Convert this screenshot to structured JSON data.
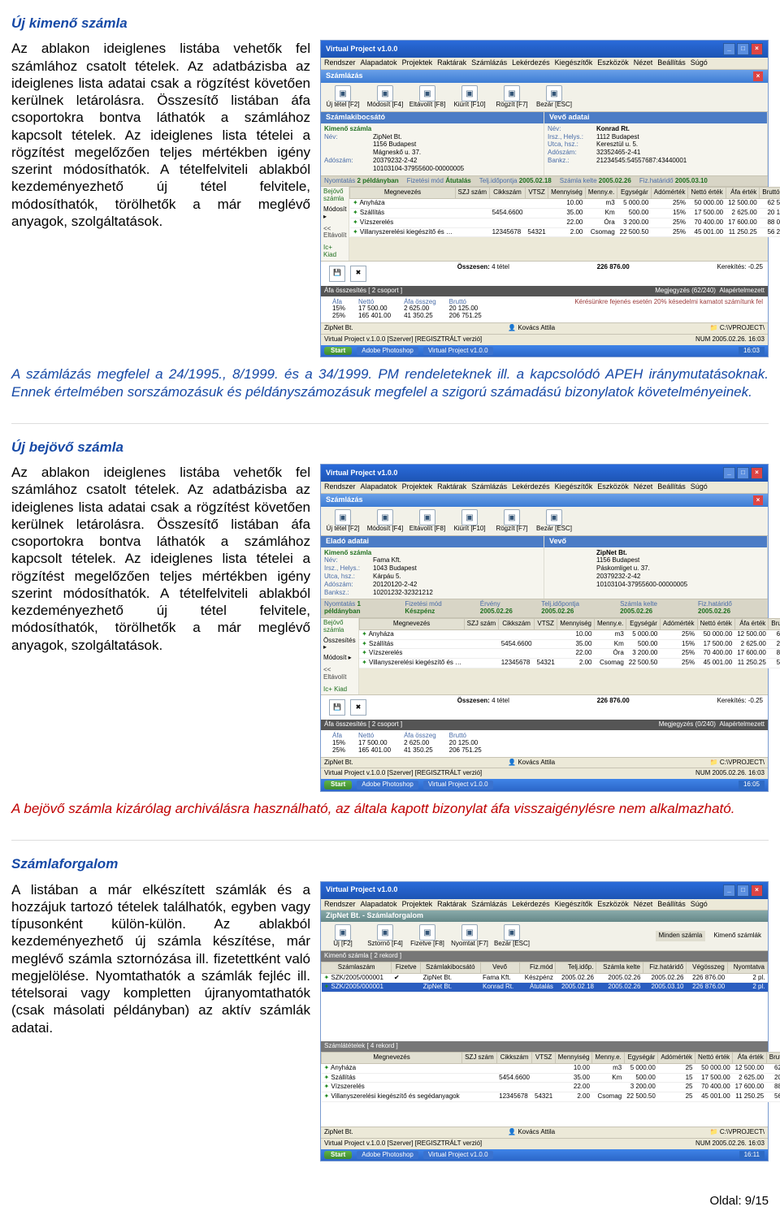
{
  "section1": {
    "heading": "Új kimenő számla",
    "para1": "Az ablakon ideiglenes listába vehetők fel számlához csatolt tételek. Az adatbázisba az ideiglenes lista adatai csak a rögzítést követően kerülnek letárolásra. Összesítő listában áfa csoportokra bontva láthatók a számlához kapcsolt tételek. Az ideiglenes lista tételei a rögzítést megelőzően teljes mértékben igény szerint módosíthatók. A tételfelviteli ablakból kezdeményezhető új tétel felvitele, módosíthatók, törölhetők a már meglévő anyagok, szolgáltatások.",
    "blue": "A számlázás megfelel a 24/1995., 8/1999. és a 34/1999. PM rendeleteknek ill. a kapcsolódó APEH iránymutatásoknak. Ennek értelmében sorszámozásuk és példányszámozásuk megfelel a szigorú számadású bizonylatok követelményeinek."
  },
  "section2": {
    "heading": "Új bejövő számla",
    "para1": "Az ablakon ideiglenes listába vehetők fel számlához csatolt tételek. Az adatbázisba az ideiglenes lista adatai csak a rögzítést követően kerülnek letárolásra. Összesítő listában áfa csoportokra bontva láthatók a számlához kapcsolt tételek. Az ideiglenes lista tételei a rögzítést megelőzően teljes mértékben igény szerint módosíthatók. A tételfelviteli ablakból kezdeményezhető új tétel felvitele, módosíthatók, törölhetők a már meglévő anyagok, szolgáltatások.",
    "red": "A bejövő számla kizárólag archiválásra használható, az általa kapott bizonylat áfa visszaigénylésre nem alkalmazható."
  },
  "section3": {
    "heading": "Számlaforgalom",
    "para1": "A listában a már elkészített számlák és a hozzájuk tartozó tételek találhatók, egyben vagy típusonként külön-külön. Az ablakból kezdeményezhető új számla készítése, már meglévő számla sztornózása ill. fizetettként való megjelölése. Nyomtathatók a számlák fejléc ill. tételsorai vagy kompletten újranyomtathatók (csak másolati példányban) az aktív számlák adatai."
  },
  "footer": "Oldal: 9/15",
  "shot_common": {
    "title": "Virtual Project v1.0.0",
    "menus": [
      "Rendszer",
      "Alapadatok",
      "Projektek",
      "Raktárak",
      "Számlázás",
      "Lekérdezés",
      "Kiegészítők",
      "Eszközök",
      "Nézet",
      "Beállítás",
      "Súgó"
    ],
    "subtitle": "Számlázás",
    "toolbar": [
      {
        "k": "Új tétel [F2]"
      },
      {
        "k": "Módosít [F4]"
      },
      {
        "k": "Eltávolít [F8]"
      },
      {
        "k": "Kiürít [F10]"
      },
      {
        "k": "Rögzít [F7]"
      },
      {
        "k": "Bezár [ESC]"
      }
    ],
    "grid_headers": [
      "Megnevezés",
      "SZJ szám",
      "Cikkszám",
      "VTSZ",
      "Mennyiség",
      "Menny.e.",
      "Egységár",
      "Adómérték",
      "Nettó érték",
      "Áfa érték",
      "Bruttó érték"
    ],
    "grid_rows": [
      [
        "Anyháza",
        "",
        "",
        "",
        "10.00",
        "m3",
        "5 000.00",
        "25%",
        "50 000.00",
        "12 500.00",
        "62 500.00"
      ],
      [
        "Szállítás",
        "",
        "5454.6600",
        "",
        "35.00",
        "Km",
        "500.00",
        "15%",
        "17 500.00",
        "2 625.00",
        "20 125.00"
      ],
      [
        "Vízszerelés",
        "",
        "",
        "",
        "22.00",
        "Óra",
        "3 200.00",
        "25%",
        "70 400.00",
        "17 600.00",
        "88 000.00"
      ],
      [
        "Villanyszerelési kiegészítő és …",
        "",
        "12345678",
        "54321",
        "2.00",
        "Csomag",
        "22 500.50",
        "25%",
        "45 001.00",
        "11 250.25",
        "56 251.25"
      ]
    ],
    "sum_label": "Összesen:",
    "sum_count": "4 tétel",
    "sum_total": "226 876.00",
    "kerekites": "Kerekítés: -0.25",
    "afa_bar": "Áfa összesítés [ 2 csoport ]",
    "meg_bar1": "Megjegyzés (62/240)",
    "meg_note1": "Kérésünkre fejenés esetén 20% késedelmi kamatot számítunk fel",
    "meg_bar2": "Megjegyzés (0/240)",
    "vat_headers": [
      "Áfa",
      "Nettó",
      "Áfa összeg",
      "Bruttó"
    ],
    "vat_rows": [
      [
        "15%",
        "17 500.00",
        "2 625.00",
        "20 125.00"
      ],
      [
        "25%",
        "165 401.00",
        "41 350.25",
        "206 751.25"
      ]
    ],
    "status_left": "ZipNet Bt.",
    "status_mid1": "Kovács Attila",
    "status_mid2": "C:\\VPROJECT\\",
    "status_line2": "Virtual Project v.1.0.0 [Szerver] [REGISZTRÁLT verzió]",
    "status_right": "NUM    2005.02.26. 16:03",
    "task_items": [
      "Adobe Photoshop",
      "Virtual Project v1.0.0"
    ],
    "task_clock1": "16:03",
    "task_clock2": "16:05",
    "task_clock3": "16:11",
    "side_items": [
      "Kimenő számla",
      "",
      "Bejövő számla"
    ],
    "side_buttons": [
      "<< Eltávolít",
      "Ic+ Kiad"
    ],
    "iconlabels": [
      "Rögzítés",
      "Bezárás"
    ],
    "alap": "Alapértelmezett"
  },
  "shot1": {
    "left_h": "Számlakibocsátó",
    "right_h": "Vevő adatai",
    "company": "Konrad Rt.",
    "left_rows": [
      [
        "Név:",
        "ZipNet Bt."
      ],
      [
        "",
        "1156    Budapest"
      ],
      [
        "",
        "Mágneskő u. 37."
      ],
      [
        "Adószám:",
        "20379232-2-42"
      ],
      [
        "",
        "10103104-37955600-00000005"
      ]
    ],
    "right_rows": [
      [
        "Irsz., Helys.:",
        "1112    Budapest"
      ],
      [
        "Utca, hsz.:",
        "Keresztül u. 5."
      ],
      [
        "Adószám:",
        "32352465-2-41"
      ],
      [
        "Bankz.:",
        "21234545:54557687:43440001"
      ]
    ],
    "greybar": [
      [
        "Nyomtatás",
        "2 példányban"
      ],
      [
        "Fizetési mód",
        "Átutalás"
      ],
      [
        "Telj.időpontja",
        "2005.02.18"
      ],
      [
        "Számla kelte",
        "2005.02.26"
      ],
      [
        "Fiz.határidő",
        "2005.03.10"
      ]
    ]
  },
  "shot2": {
    "left_h": "Eladó adatai",
    "right_h": "Vevő",
    "company": "ZipNet Bt.",
    "left_rows": [
      [
        "Név:",
        "Fama Kft."
      ],
      [
        "Irsz., Helys.:",
        "1043    Budapest"
      ],
      [
        "Utca, hsz.:",
        "Kárpáu 5."
      ],
      [
        "Adószám:",
        "20120120-2-42"
      ],
      [
        "Banksz.:",
        "10201232-32321212"
      ]
    ],
    "right_rows": [
      [
        "",
        "1156    Budapest"
      ],
      [
        "",
        "Páskomliget u. 37."
      ],
      [
        "",
        "20379232-2-42"
      ],
      [
        "",
        "10103104-37955600-00000005"
      ]
    ],
    "greybar": [
      [
        "Nyomtatás",
        "1 példányban"
      ],
      [
        "Fizetési mód",
        "Készpénz"
      ],
      [
        "Érvény",
        "2005.02.26"
      ],
      [
        "Telj.időpontja",
        "2005.02.26"
      ],
      [
        "Számla kelte",
        "2005.02.26"
      ],
      [
        "Fiz.határidő",
        "2005.02.26"
      ]
    ]
  },
  "shot3": {
    "list_sub": "ZipNet Bt. - Számlaforgalom",
    "toolbar": [
      {
        "k": "Új [F2]"
      },
      {
        "k": "Sztornó [F4]"
      },
      {
        "k": "Fizetve [F8]"
      },
      {
        "k": "Nyomtat [F7]"
      },
      {
        "k": "Bezár [ESC]"
      }
    ],
    "tabbar": [
      "Minden számla",
      "Kimenő számlák",
      "..."
    ],
    "top_bar": "Kimenő számla [ 2 rekord ]",
    "top_headers": [
      "Számlaszám",
      "Fizetve",
      "Számlakibocsátó",
      "Vevő",
      "Fiz.mód",
      "Telj.időp.",
      "Számla kelte",
      "Fiz.határidő",
      "Végösszeg",
      "Nyomtatva"
    ],
    "top_rows": [
      [
        "SZK/2005/000001",
        "✔",
        "ZipNet Bt.",
        "Fama Kft.",
        "Készpénz",
        "2005.02.26",
        "2005.02.26",
        "2005.02.26",
        "226 876.00",
        "2 pl."
      ],
      [
        "SZK/2005/000001",
        "",
        "ZipNet Bt.",
        "Konrad Rt.",
        "Átutalás",
        "2005.02.18",
        "2005.02.26",
        "2005.03.10",
        "226 876.00",
        "2 pl."
      ]
    ],
    "detail_bar": "Számlátételek [ 4 rekord ]",
    "detail_headers": [
      "Megnevezés",
      "SZJ szám",
      "Cikkszám",
      "VTSZ",
      "Mennyiség",
      "Menny.e.",
      "Egységár",
      "Adómérték",
      "Nettó érték",
      "Áfa érték",
      "Bruttó érték"
    ],
    "detail_rows": [
      [
        "Anyháza",
        "",
        "",
        "",
        "10.00",
        "m3",
        "5 000.00",
        "25",
        "50 000.00",
        "12 500.00",
        "62 500.00"
      ],
      [
        "Szállítás",
        "",
        "5454.6600",
        "",
        "35.00",
        "Km",
        "500.00",
        "15",
        "17 500.00",
        "2 625.00",
        "20 125.00"
      ],
      [
        "Vízszerelés",
        "",
        "",
        "",
        "22.00",
        "",
        "3 200.00",
        "25",
        "70 400.00",
        "17 600.00",
        "88 000.00"
      ],
      [
        "Villanyszerelési kiegészítő és segédanyagok",
        "",
        "12345678",
        "54321",
        "2.00",
        "Csomag",
        "22 500.50",
        "25",
        "45 001.00",
        "11 250.25",
        "56 251.25"
      ]
    ]
  }
}
